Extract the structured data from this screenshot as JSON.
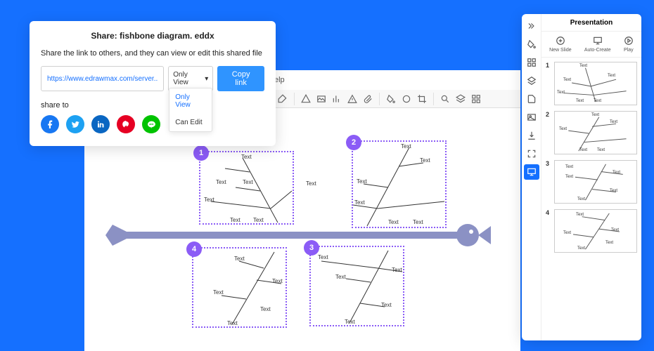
{
  "share": {
    "title": "Share: fishbone diagram. eddx",
    "desc": "Share the link to others, and they can view or edit this shared file",
    "url": "https://www.edrawmax.com/server..",
    "perm_selected": "Only View",
    "perm_options": [
      "Only View",
      "Can Edit"
    ],
    "copy_btn": "Copy link",
    "share_to": "share to"
  },
  "help_menu": "elp",
  "diagram": {
    "center_text": "Text",
    "label": "Text",
    "badges": [
      "1",
      "2",
      "3",
      "4"
    ]
  },
  "presentation": {
    "title": "Presentation",
    "actions": {
      "new_slide": "New Slide",
      "auto_create": "Auto-Create",
      "play": "Play"
    },
    "slides": [
      "1",
      "2",
      "3",
      "4"
    ]
  }
}
